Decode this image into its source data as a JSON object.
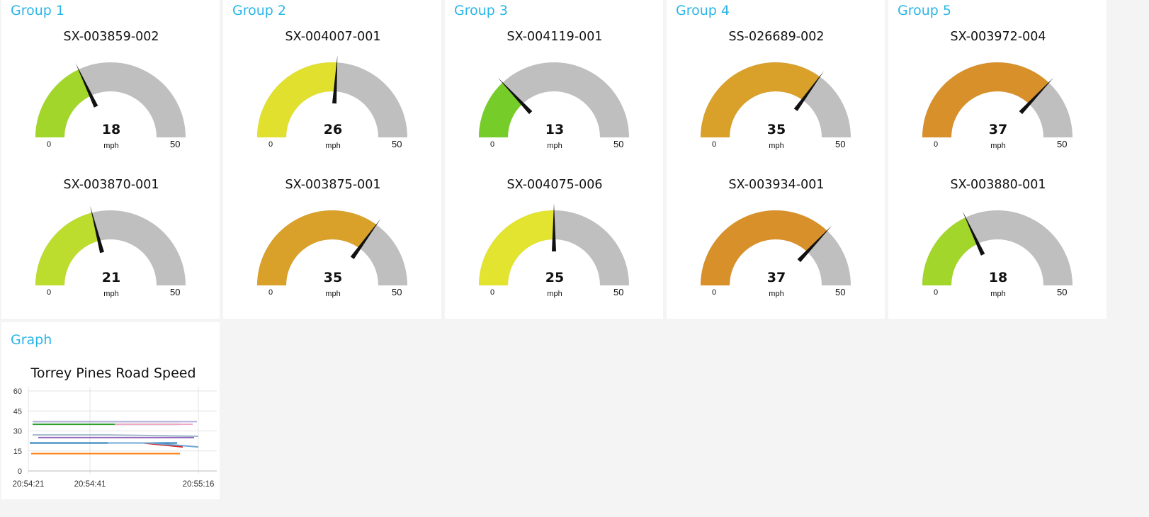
{
  "groups": [
    {
      "title": "Group 1",
      "gauges": [
        {
          "name": "SX-003859-002",
          "value": 18,
          "color": "#a3d62a"
        },
        {
          "name": "SX-003870-001",
          "value": 21,
          "color": "#bcdc2e"
        }
      ]
    },
    {
      "title": "Group 2",
      "gauges": [
        {
          "name": "SX-004007-001",
          "value": 26,
          "color": "#e1e02f"
        },
        {
          "name": "SX-003875-001",
          "value": 35,
          "color": "#d9a02a"
        }
      ]
    },
    {
      "title": "Group 3",
      "gauges": [
        {
          "name": "SX-004119-001",
          "value": 13,
          "color": "#76cc28"
        },
        {
          "name": "SX-004075-006",
          "value": 25,
          "color": "#e2e42f"
        }
      ]
    },
    {
      "title": "Group 4",
      "gauges": [
        {
          "name": "SS-026689-002",
          "value": 35,
          "color": "#d9a02a"
        },
        {
          "name": "SX-003934-001",
          "value": 37,
          "color": "#d8902a"
        }
      ]
    },
    {
      "title": "Group 5",
      "gauges": [
        {
          "name": "SX-003972-004",
          "value": 37,
          "color": "#d8902a"
        },
        {
          "name": "SX-003880-001",
          "value": 18,
          "color": "#a3d62a"
        }
      ]
    }
  ],
  "gauge_scale": {
    "min": "0",
    "max": "50",
    "unit": "mph"
  },
  "graph": {
    "group_title": "Graph",
    "chart_data": {
      "type": "line",
      "title": "Torrey Pines Road Speed",
      "ylim": [
        0,
        60
      ],
      "yticks": [
        "60",
        "45",
        "30",
        "15",
        "0"
      ],
      "xticks": [
        "20:54:21",
        "20:54:41",
        "20:55:16"
      ],
      "grid": true,
      "series": [
        {
          "color": "#8fd18f",
          "values": [
            37,
            37,
            37
          ]
        },
        {
          "color": "#2ca02c",
          "values": [
            35,
            35,
            35
          ]
        },
        {
          "color": "#b5aede",
          "values": [
            37,
            37,
            37
          ]
        },
        {
          "color": "#f2a6c8",
          "values": [
            35,
            35,
            35
          ]
        },
        {
          "color": "#a0b8cc",
          "values": [
            27,
            27,
            26
          ]
        },
        {
          "color": "#9467bd",
          "values": [
            25,
            25,
            25
          ]
        },
        {
          "color": "#1f77b4",
          "values": [
            21,
            21,
            21
          ]
        },
        {
          "color": "#d62728",
          "values": [
            21,
            21,
            18
          ]
        },
        {
          "color": "#6fa9d4",
          "values": [
            21,
            21,
            18
          ]
        },
        {
          "color": "#ff7f0e",
          "values": [
            13,
            13,
            13
          ]
        }
      ]
    }
  }
}
